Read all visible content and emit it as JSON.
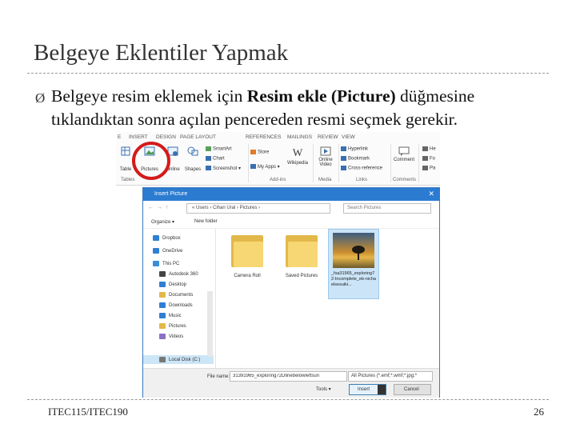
{
  "slide": {
    "title": "Belgeye Eklentiler Yapmak",
    "bullet_marker": "Ø",
    "bullet_text_1": "Belgeye resim eklemek için ",
    "bullet_bold": "Resim ekle (Picture)",
    "bullet_text_2": " düğmesine tıklandıktan sonra açılan pencereden resmi seçmek gerekir.",
    "footer_left": "ITEC115/ITEC190",
    "page_number": "26"
  },
  "ribbon": {
    "tabs": [
      "E",
      "INSERT",
      "DESIGN",
      "PAGE LAYOUT",
      "REFERENCES",
      "MAILINGS",
      "REVIEW",
      "VIEW"
    ],
    "tables_label": "Table",
    "pictures_label": "Pictures",
    "online_label": "Online",
    "shapes_label": "Shapes",
    "smartart_label": "SmartArt",
    "chart_label": "Chart",
    "screenshot_label": "Screenshot",
    "store_label": "Store",
    "myapps_label": "My Apps",
    "wikipedia_label": "Wikipedia",
    "online_video_label": "Online Video",
    "hyperlink_label": "Hyperlink",
    "bookmark_label": "Bookmark",
    "crossref_label": "Cross-reference",
    "comment_label": "Comment",
    "group_tables": "Tables",
    "group_addins": "Add-ins",
    "group_media": "Media",
    "group_links": "Links",
    "group_comments": "Comments",
    "right_labels": [
      "He",
      "Fo",
      "Pa"
    ]
  },
  "dialog": {
    "title": "Insert Picture",
    "close": "✕",
    "path": "«  Users  ›  Cihan Ural  ›  Pictures  ›",
    "search_placeholder": "Search Pictures",
    "organize": "Organize ▾",
    "new_folder": "New folder",
    "nav_items": [
      "Dropbox",
      "OneDrive",
      "This PC",
      "Autodesk 360",
      "Desktop",
      "Documents",
      "Downloads",
      "Music",
      "Pictures",
      "Videos",
      "Local Disk (C:)"
    ],
    "files": [
      {
        "name": "Camera Roll"
      },
      {
        "name": "Saved Pictures"
      },
      {
        "name": "_fsa31965_exploring72-Incomplete_eb-nichaelsesuiki..."
      }
    ],
    "filename_label": "File name:",
    "filename_value": "31391965_exploring72Dlinebelowleftsuri",
    "filetype_value": "All Pictures (*.emf;*.wmf;*.jpg;*",
    "tools_label": "Tools ▾",
    "insert_label": "Insert",
    "cancel_label": "Cancel"
  }
}
